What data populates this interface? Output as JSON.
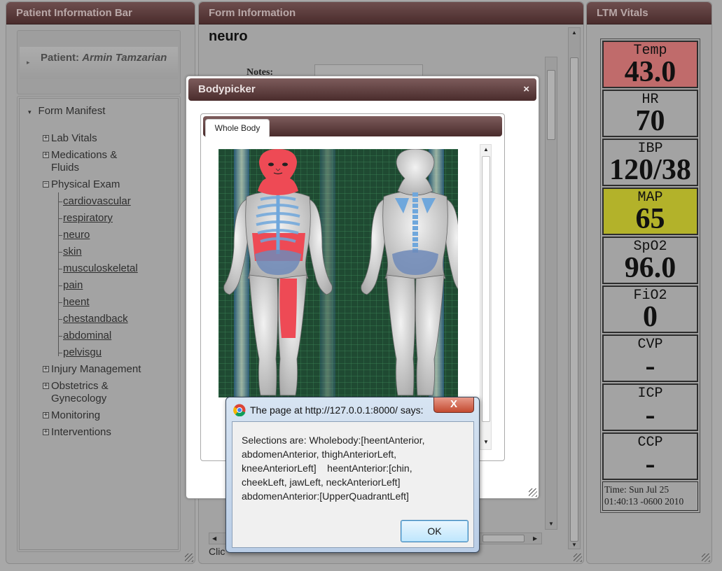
{
  "left_panel": {
    "title": "Patient Information Bar",
    "patient_prefix": "Patient:",
    "patient_name": "Armin Tamzarian",
    "manifest_title": "Form Manifest",
    "tree": [
      {
        "label": "Lab Vitals",
        "expanded": false
      },
      {
        "label": "Medications & Fluids",
        "expanded": false
      },
      {
        "label": "Physical Exam",
        "expanded": true,
        "children": [
          "cardiovascular",
          "respiratory",
          "neuro",
          "skin",
          "musculoskeletal",
          "pain",
          "heent",
          "chestandback",
          "abdominal",
          "pelvisgu"
        ]
      },
      {
        "label": "Injury Management",
        "expanded": false
      },
      {
        "label": "Obstetrics & Gynecology",
        "expanded": false
      },
      {
        "label": "Monitoring",
        "expanded": false
      },
      {
        "label": "Interventions",
        "expanded": false
      }
    ]
  },
  "center_panel": {
    "title": "Form Information",
    "form_name": "neuro",
    "notes_label": "Notes:",
    "bottom_text": "Clic"
  },
  "right_panel": {
    "title": "LTM Vitals",
    "vitals": [
      {
        "label": "Temp",
        "value": "43.0",
        "bg": "#c06b6b"
      },
      {
        "label": "HR",
        "value": "70",
        "bg": ""
      },
      {
        "label": "IBP",
        "value": "120/38",
        "bg": ""
      },
      {
        "label": "MAP",
        "value": "65",
        "bg": "#b3b22a"
      },
      {
        "label": "SpO2",
        "value": "96.0",
        "bg": ""
      },
      {
        "label": "FiO2",
        "value": "0",
        "bg": ""
      },
      {
        "label": "CVP",
        "value": "-",
        "bg": ""
      },
      {
        "label": "ICP",
        "value": "-",
        "bg": ""
      },
      {
        "label": "CCP",
        "value": "-",
        "bg": ""
      }
    ],
    "time_line1": "Time: Sun Jul 25",
    "time_line2": "01:40:13 -0600 2010"
  },
  "bodypicker": {
    "title": "Bodypicker",
    "close_glyph": "×",
    "tab_label": "Whole Body"
  },
  "alert": {
    "title": "The page at http://127.0.0.1:8000/ says:",
    "close_glyph": "X",
    "lines": [
      "Selections are: Wholebody:[heentAnterior,",
      "abdomenAnterior, thighAnteriorLeft,",
      "kneeAnteriorLeft]    heentAnterior:[chin,",
      "cheekLeft, jawLeft, neckAnteriorLeft]",
      "abdomenAnterior:[UpperQuadrantLeft]"
    ],
    "ok_label": "OK"
  },
  "colors": {
    "header_top": "#6e4e4e",
    "header_bottom": "#4a2c2c",
    "selected_region": "#ee4a55",
    "skeleton_blue": "#6fa7dc",
    "grid_green": "#1f4a32"
  }
}
